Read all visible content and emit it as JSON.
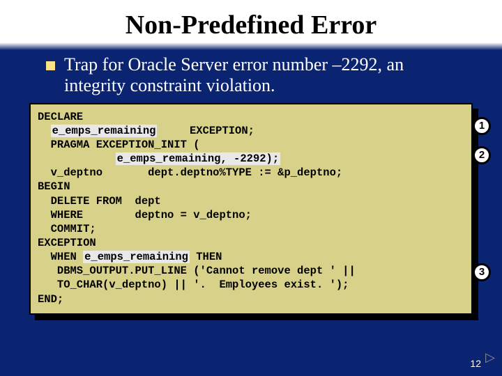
{
  "title": "Non-Predefined Error",
  "bullet": "Trap for Oracle Server error number –2292, an integrity constraint violation.",
  "code": {
    "l1": "DECLARE",
    "l2a": "  ",
    "l2b": "e_emps_remaining",
    "l2c": "     EXCEPTION;",
    "l3a": "  PRAGMA EXCEPTION_INIT (",
    "l4a": "            ",
    "l4b": "e_emps_remaining, -2292);",
    "l5": "  v_deptno       dept.deptno%TYPE := &p_deptno;",
    "l6": "BEGIN",
    "l7": "  DELETE FROM  dept",
    "l8": "  WHERE        deptno = v_deptno;",
    "l9": "  COMMIT;",
    "l10": "EXCEPTION",
    "l11a": "  WHEN ",
    "l11b": "e_emps_remaining",
    "l11c": " THEN",
    "l12": "   DBMS_OUTPUT.PUT_LINE ('Cannot remove dept ' ||",
    "l13": "   TO_CHAR(v_deptno) || '.  Employees exist. ');",
    "l14": "END;"
  },
  "callouts": {
    "c1": "1",
    "c2": "2",
    "c3": "3"
  },
  "pagenum": "12"
}
